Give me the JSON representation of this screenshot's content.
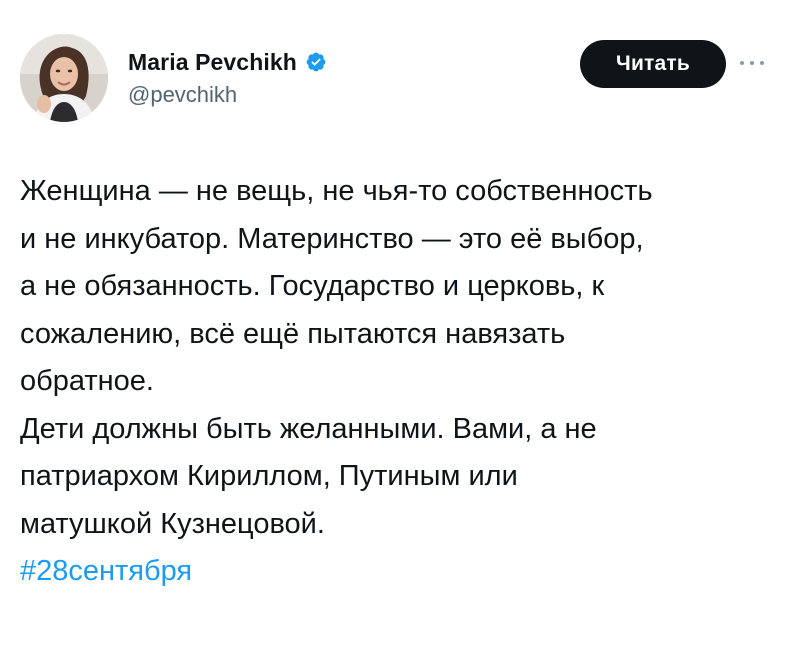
{
  "author": {
    "display_name": "Maria Pevchikh",
    "handle": "@pevchikh",
    "verified": true,
    "avatar_icon": "profile-photo"
  },
  "actions": {
    "follow_label": "Читать",
    "more_icon": "more-horizontal-icon"
  },
  "tweet": {
    "paragraph_1": [
      "Женщина — не вещь, не чья-то собственность",
      "и не инкубатор. Материнство — это её выбор,",
      "а не обязанность. Государство и церковь, к",
      "сожалению, всё ещё пытаются навязать",
      "обратное."
    ],
    "paragraph_2": [
      "Дети должны быть желанными. Вами, а не",
      "патриархом Кириллом, Путиным или",
      "матушкой Кузнецовой."
    ],
    "hashtag": "#28сентября"
  },
  "colors": {
    "text": "#0f1419",
    "secondary_text": "#536471",
    "link": "#1d9bf0",
    "verified_badge": "#1d9bf0",
    "button_bg": "#0f1419",
    "button_text": "#ffffff"
  }
}
